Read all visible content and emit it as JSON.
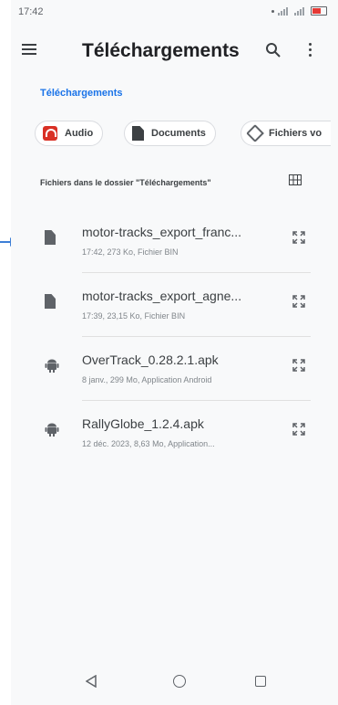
{
  "status_bar": {
    "time": "17:42"
  },
  "app_bar": {
    "title": "Téléchargements",
    "menu_icon": "menu-icon",
    "search_icon": "search-icon",
    "more_icon": "more-vert-icon"
  },
  "breadcrumb": "Téléchargements",
  "chips": [
    {
      "label": "Audio",
      "icon": "headphones-icon"
    },
    {
      "label": "Documents",
      "icon": "document-icon"
    },
    {
      "label": "Fichiers vo",
      "icon": "label-icon"
    }
  ],
  "section": {
    "label": "Fichiers dans le dossier \"Téléchargements\"",
    "view_icon": "grid-view-icon"
  },
  "files": [
    {
      "name": "motor-tracks_export_franc...",
      "meta": "17:42, 273 Ko, Fichier BIN",
      "icon": "file-icon"
    },
    {
      "name": "motor-tracks_export_agne...",
      "meta": "17:39, 23,15 Ko, Fichier BIN",
      "icon": "file-icon"
    },
    {
      "name": "OverTrack_0.28.2.1.apk",
      "meta": "8 janv., 299 Mo, Application Android",
      "icon": "android-icon"
    },
    {
      "name": "RallyGlobe_1.2.4.apk",
      "meta": "12 déc. 2023, 8,63 Mo, Application...",
      "icon": "android-icon"
    }
  ],
  "colors": {
    "accent": "#1a73e8",
    "audio_icon": "#d93025",
    "background": "#f8f9fa",
    "pointer": "#3d7fd6"
  }
}
